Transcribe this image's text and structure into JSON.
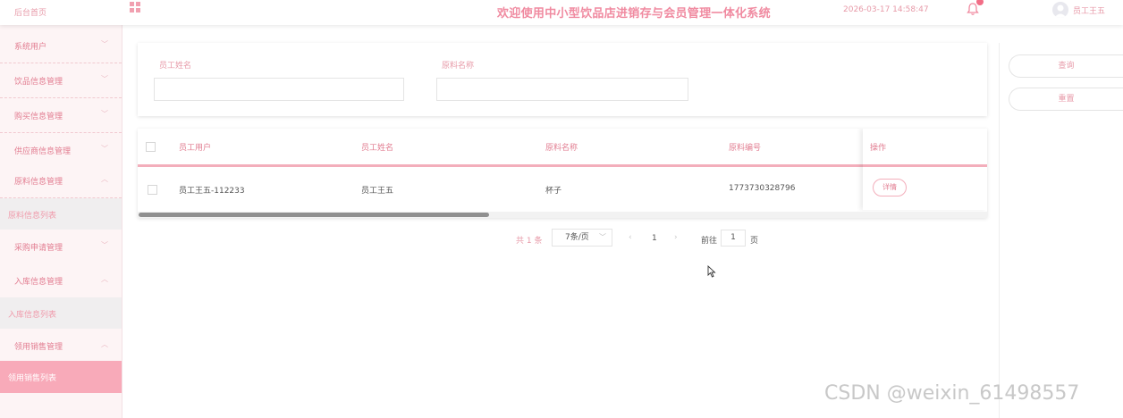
{
  "header": {
    "home": "后台首页",
    "title": "欢迎使用中小型饮品店进销存与会员管理一体化系统",
    "datetime": "2026-03-17 14:58:47",
    "user": "员工王五"
  },
  "sidebar": {
    "items": [
      {
        "label": "系统用户",
        "chevron": "﹀"
      },
      {
        "label": "饮品信息管理",
        "chevron": "﹀"
      },
      {
        "label": "购买信息管理",
        "chevron": "﹀"
      },
      {
        "label": "供应商信息管理",
        "chevron": "﹀"
      },
      {
        "label": "原料信息管理",
        "chevron": "︿"
      },
      {
        "label": "原料信息列表"
      },
      {
        "label": "采购申请管理",
        "chevron": "﹀"
      },
      {
        "label": "入库信息管理",
        "chevron": "︿"
      },
      {
        "label": "入库信息列表"
      },
      {
        "label": "领用销售管理",
        "chevron": "︿"
      },
      {
        "label": "领用销售列表"
      }
    ]
  },
  "search": {
    "field1_label": "员工姓名",
    "field2_label": "原料名称",
    "query_button": "查询",
    "reset_button": "重置"
  },
  "table": {
    "columns": [
      "员工用户",
      "员工姓名",
      "原料名称",
      "原料编号",
      "操作"
    ],
    "rows": [
      {
        "cells": [
          "员工王五-112233",
          "员工王五",
          "杯子",
          "1773730328796"
        ],
        "action": "详情"
      }
    ]
  },
  "pagination": {
    "total": "共 1 条",
    "page_size": "7条/页",
    "page_size_chevron": "﹀",
    "prev": "‹",
    "current": "1",
    "next": "›",
    "goto_label": "前往",
    "goto_value": "1",
    "page_label": "页"
  },
  "watermark": "CSDN @weixin_61498557",
  "colors": {
    "accent": "#f08aa0",
    "active_menu": "#f8aab9",
    "badge": "#f26d86"
  }
}
